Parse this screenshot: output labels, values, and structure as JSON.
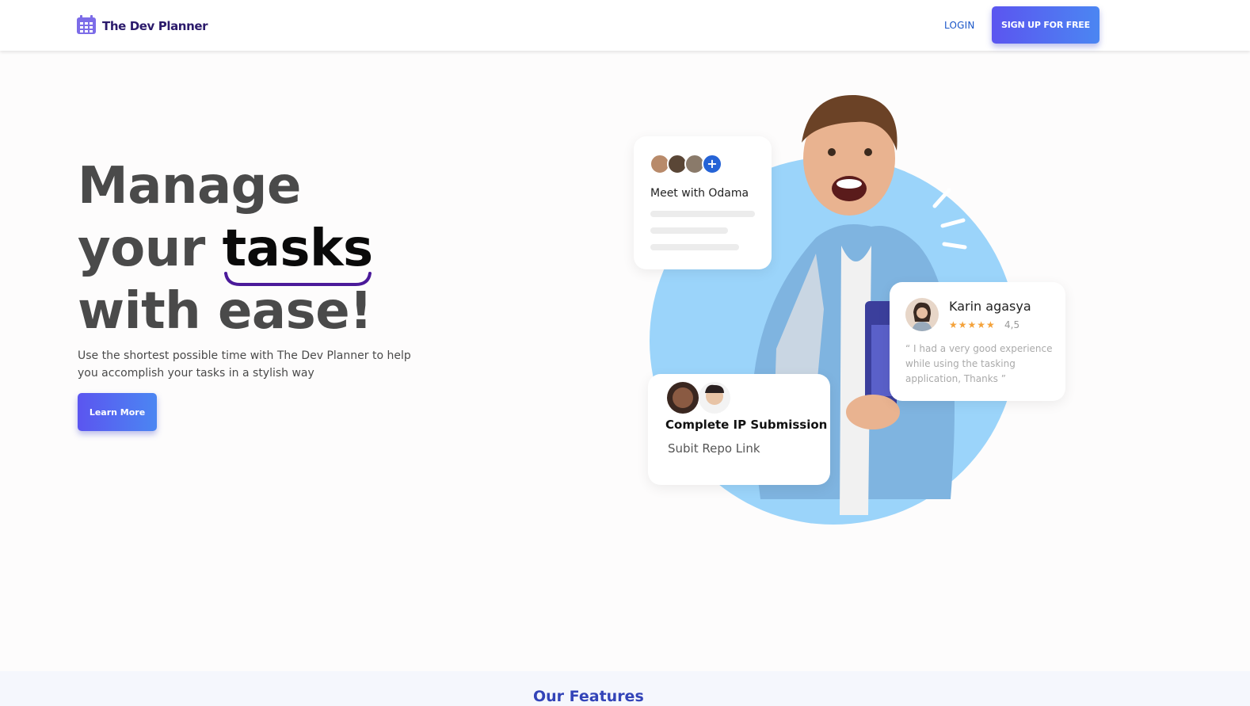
{
  "header": {
    "brand": "The Dev Planner",
    "login": "LOGIN",
    "signup": "SIGN UP FOR FREE"
  },
  "hero": {
    "headline_1": "Manage",
    "headline_2": "your ",
    "headline_highlight": "tasks",
    "headline_3": "with ease!",
    "subtitle": "Use the shortest possible time with The Dev Planner to help you accomplish your tasks in a stylish way",
    "cta": "Learn More"
  },
  "cards": {
    "meeting": {
      "title": "Meet with Odama",
      "add_icon": "+"
    },
    "review": {
      "name": "Karin agasya",
      "stars": "★★★★★",
      "rating": "4,5",
      "quote": "“ I had a very good experience while using the tasking application, Thanks ”"
    },
    "task": {
      "title": "Complete IP Submission",
      "subtitle": "Subit Repo Link"
    }
  },
  "features": {
    "title": "Our Features"
  },
  "colors": {
    "brand": "#2b1a6b",
    "accent": "#5b55f0",
    "blob": "#9bd4fa",
    "link": "#1a56c8"
  },
  "icons": {
    "logo": "calendar-icon",
    "add": "plus-icon",
    "star": "star-icon"
  }
}
